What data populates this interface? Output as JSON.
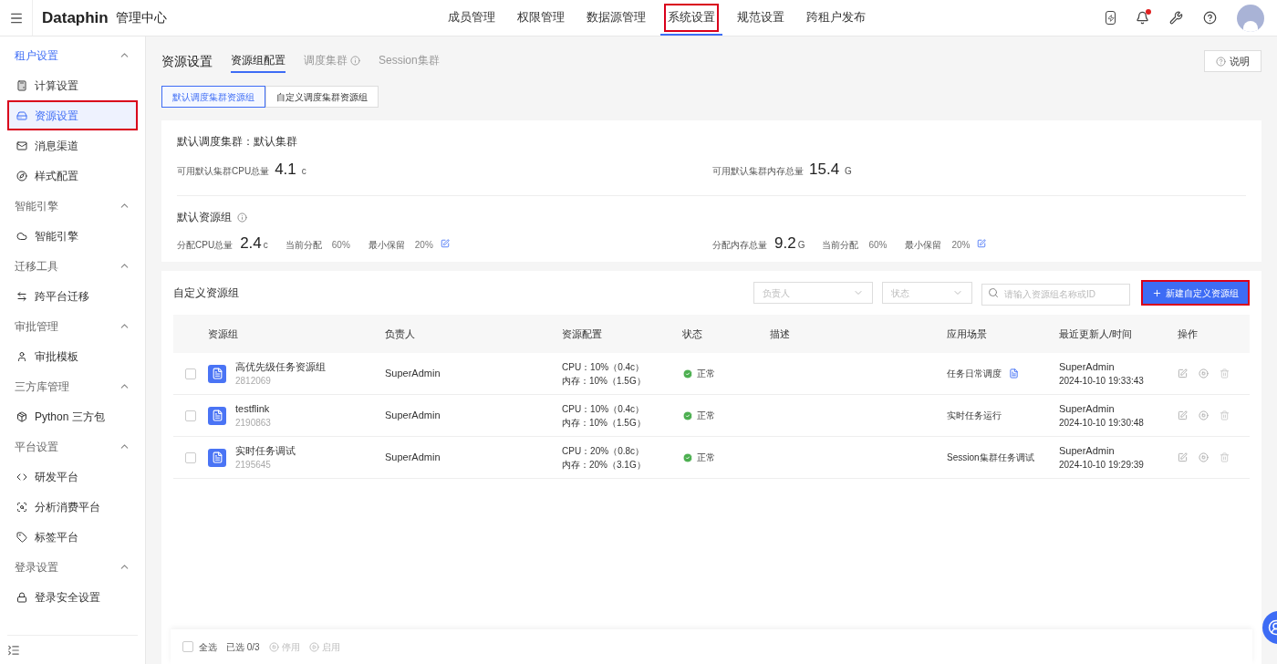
{
  "header": {
    "brand": "Dataphin",
    "title": "管理中心",
    "notification_dot": true,
    "nav": [
      {
        "label": "成员管理",
        "selected": false,
        "highlighted": false
      },
      {
        "label": "权限管理",
        "selected": false,
        "highlighted": false
      },
      {
        "label": "数据源管理",
        "selected": false,
        "highlighted": false
      },
      {
        "label": "系统设置",
        "selected": true,
        "highlighted": true
      },
      {
        "label": "规范设置",
        "selected": false,
        "highlighted": false
      },
      {
        "label": "跨租户发布",
        "selected": false,
        "highlighted": false
      }
    ]
  },
  "sidebar": {
    "groups": [
      {
        "label": "租户设置",
        "active": true,
        "expanded": true,
        "items": [
          {
            "label": "计算设置",
            "selected": false,
            "highlighted": false
          },
          {
            "label": "资源设置",
            "selected": true,
            "highlighted": true
          },
          {
            "label": "消息渠道",
            "selected": false,
            "highlighted": false
          },
          {
            "label": "样式配置",
            "selected": false,
            "highlighted": false
          }
        ]
      },
      {
        "label": "智能引擎",
        "active": false,
        "expanded": true,
        "items": [
          {
            "label": "智能引擎",
            "selected": false,
            "highlighted": false
          }
        ]
      },
      {
        "label": "迁移工具",
        "active": false,
        "expanded": true,
        "items": [
          {
            "label": "跨平台迁移",
            "selected": false,
            "highlighted": false
          }
        ]
      },
      {
        "label": "审批管理",
        "active": false,
        "expanded": true,
        "items": [
          {
            "label": "审批模板",
            "selected": false,
            "highlighted": false
          }
        ]
      },
      {
        "label": "三方库管理",
        "active": false,
        "expanded": true,
        "items": [
          {
            "label": "Python 三方包",
            "selected": false,
            "highlighted": false
          }
        ]
      },
      {
        "label": "平台设置",
        "active": false,
        "expanded": true,
        "items": [
          {
            "label": "研发平台",
            "selected": false,
            "highlighted": false
          },
          {
            "label": "分析消费平台",
            "selected": false,
            "highlighted": false
          },
          {
            "label": "标签平台",
            "selected": false,
            "highlighted": false
          }
        ]
      },
      {
        "label": "登录设置",
        "active": false,
        "expanded": true,
        "items": [
          {
            "label": "登录安全设置",
            "selected": false,
            "highlighted": false
          }
        ]
      }
    ]
  },
  "page": {
    "title": "资源设置",
    "help_button": "说明",
    "tabs": [
      {
        "label": "资源组配置",
        "selected": true
      },
      {
        "label": "调度集群",
        "selected": false
      },
      {
        "label": "Session集群",
        "selected": false
      }
    ],
    "segments": [
      {
        "label": "默认调度集群资源组",
        "selected": true
      },
      {
        "label": "自定义调度集群资源组",
        "selected": false
      }
    ]
  },
  "default_cluster": {
    "title": "默认调度集群：默认集群",
    "stats": [
      {
        "label": "可用默认集群CPU总量",
        "value": "4.1",
        "unit": "c"
      },
      {
        "label": "可用默认集群内存总量",
        "value": "15.4",
        "unit": "G"
      }
    ]
  },
  "default_group": {
    "title": "默认资源组",
    "allocations": [
      {
        "label": "分配CPU总量",
        "value": "2.4",
        "unit": "c",
        "current_label": "当前分配",
        "current": "60%",
        "min_label": "最小保留",
        "min": "20%"
      },
      {
        "label": "分配内存总量",
        "value": "9.2",
        "unit": "G",
        "current_label": "当前分配",
        "current": "60%",
        "min_label": "最小保留",
        "min": "20%"
      }
    ]
  },
  "custom_groups": {
    "title": "自定义资源组",
    "owner_filter": {
      "placeholder": "负责人"
    },
    "status_filter": {
      "placeholder": "状态"
    },
    "search": {
      "placeholder": "请输入资源组名称或ID"
    },
    "new_button": {
      "label": "新建自定义资源组",
      "highlighted": true
    },
    "columns": [
      "资源组",
      "负责人",
      "资源配置",
      "状态",
      "描述",
      "应用场景",
      "最近更新人/时间",
      "操作"
    ],
    "rows": [
      {
        "checked": false,
        "name": "高优先级任务资源组",
        "id": "2812069",
        "owner": "SuperAdmin",
        "cpu": "CPU：10%（0.4c）",
        "memory": "内存：10%（1.5G）",
        "status": "正常",
        "scene": "任务日常调度",
        "scene_doc": true,
        "updater": "SuperAdmin",
        "time": "2024-10-10 19:33:43"
      },
      {
        "checked": false,
        "name": "testflink",
        "id": "2190863",
        "owner": "SuperAdmin",
        "cpu": "CPU：10%（0.4c）",
        "memory": "内存：10%（1.5G）",
        "status": "正常",
        "scene": "实时任务运行",
        "scene_doc": false,
        "updater": "SuperAdmin",
        "time": "2024-10-10 19:30:48"
      },
      {
        "checked": false,
        "name": "实时任务调试",
        "id": "2195645",
        "owner": "SuperAdmin",
        "cpu": "CPU：20%（0.8c）",
        "memory": "内存：20%（3.1G）",
        "status": "正常",
        "scene": "Session集群任务调试",
        "scene_doc": false,
        "updater": "SuperAdmin",
        "time": "2024-10-10 19:29:39"
      }
    ],
    "footer": {
      "select_all": "全选",
      "select_all_checked": false,
      "selected_count": "已选 0/3",
      "actions": [
        {
          "label": "停用",
          "disabled": true
        },
        {
          "label": "启用",
          "disabled": true
        }
      ]
    }
  }
}
